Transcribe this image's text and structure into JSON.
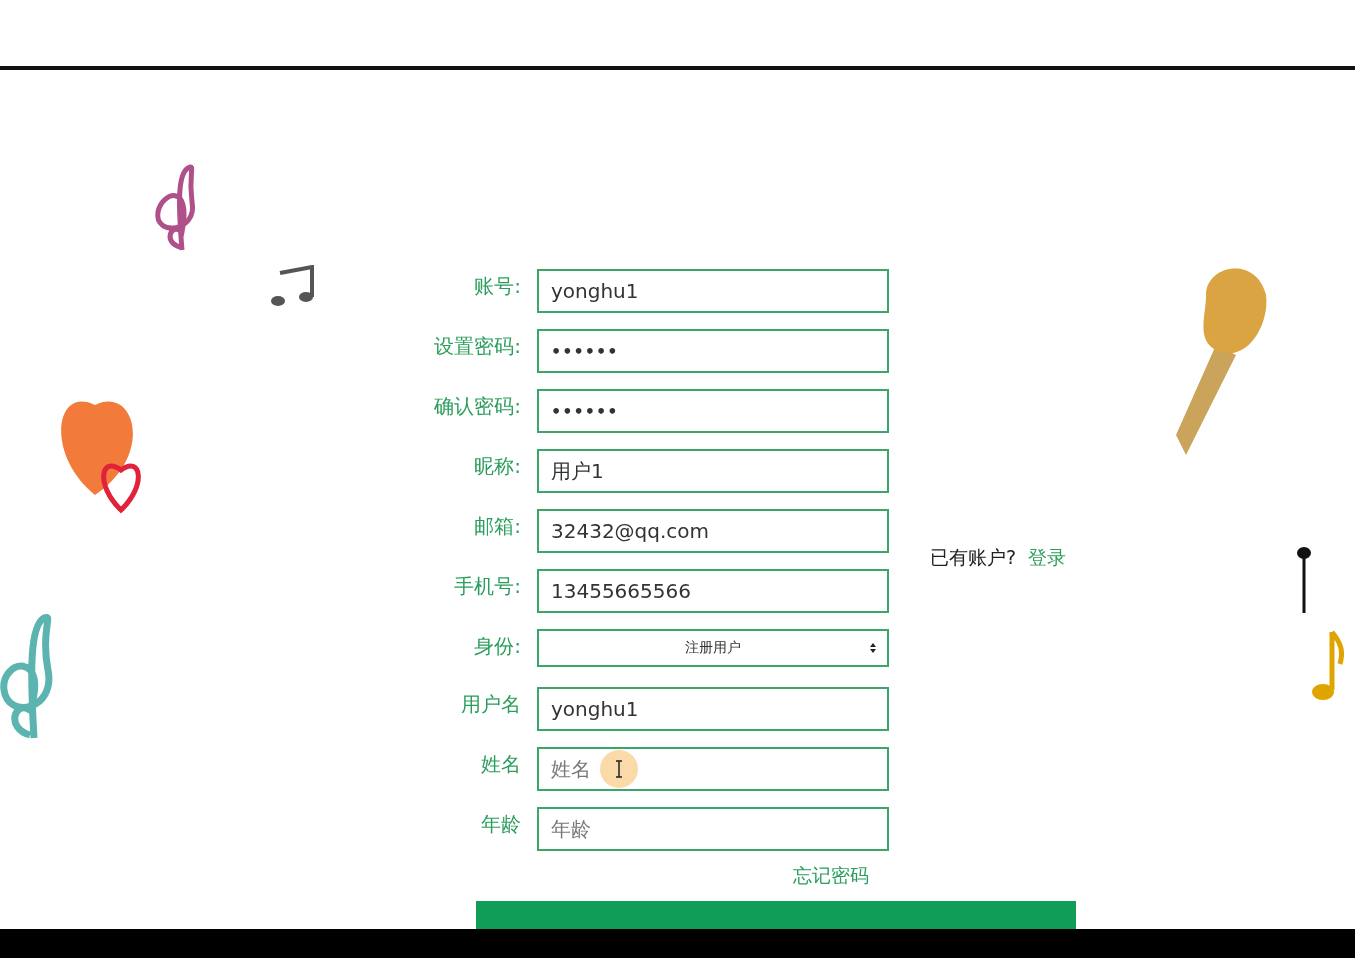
{
  "form": {
    "fields": [
      {
        "label": "账号:",
        "kind": "text",
        "value": "yonghu1"
      },
      {
        "label": "设置密码:",
        "kind": "password",
        "value": "••••••"
      },
      {
        "label": "确认密码:",
        "kind": "password",
        "value": "••••••"
      },
      {
        "label": "昵称:",
        "kind": "text",
        "value": "用户1"
      },
      {
        "label": "邮箱:",
        "kind": "text",
        "value": "32432@qq.com"
      },
      {
        "label": "手机号:",
        "kind": "text",
        "value": "13455665566"
      },
      {
        "label": "身份:",
        "kind": "select",
        "value": "注册用户"
      },
      {
        "label": "用户名",
        "kind": "text",
        "value": "yonghu1"
      },
      {
        "label": "姓名",
        "kind": "text",
        "placeholder": "姓名",
        "cursor": true
      },
      {
        "label": "年龄",
        "kind": "text",
        "placeholder": "年龄"
      }
    ],
    "forgot_link": "忘记密码",
    "has_account": {
      "text": "已有账户?",
      "link": "登录"
    }
  }
}
